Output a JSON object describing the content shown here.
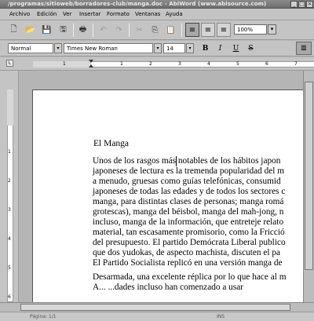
{
  "window": {
    "title": "/programas/sitioweb/borradores-club/manga.doc - AbiWord (www.abisource.com)"
  },
  "menu": [
    "Archivo",
    "Edición",
    "Ver",
    "Insertar",
    "Formato",
    "Ventanas",
    "Ayuda"
  ],
  "toolbar": {
    "zoom": "100%"
  },
  "format_bar": {
    "style": "Normal",
    "font": "Times New Roman",
    "size": "14",
    "bold": "B",
    "italic": "I",
    "underline": "U",
    "strike": "S"
  },
  "ruler": {
    "h_numbers": [
      "1",
      "1",
      "2",
      "3",
      "4",
      "5",
      "6",
      "7"
    ],
    "v_numbers": [
      "1",
      "2",
      "3",
      "4",
      "5",
      "6"
    ]
  },
  "document": {
    "heading": "El Manga",
    "lines": [
      "Unos de los rasgos más notables de los hábitos japon",
      "japoneses de lectura es la tremenda popularidad del m",
      "a menudo, gruesas como guías telefónicas, consumid",
      "japoneses de todas las edades y de todos los sectores c",
      "manga, para distintas clases de personas; manga romá",
      "grotescas), manga del béisbol, manga del mah-jong, n",
      "incluso, manga de la información, que entreteje relato",
      "material, tan escasamente promisorio, como la Fricció",
      "del presupuesto. El partido Demócrata Liberal publico",
      "que dos yudokas, de aspecto machista, discuten el pa",
      "El Partido Socialista replicó en una versión manga de",
      "Desarmada, una excelente réplica por lo que hace al m",
      "A... ...dades incluso han comenzado a usar"
    ]
  },
  "status": {
    "page": "Página: 1/1",
    "mode": "INS"
  }
}
